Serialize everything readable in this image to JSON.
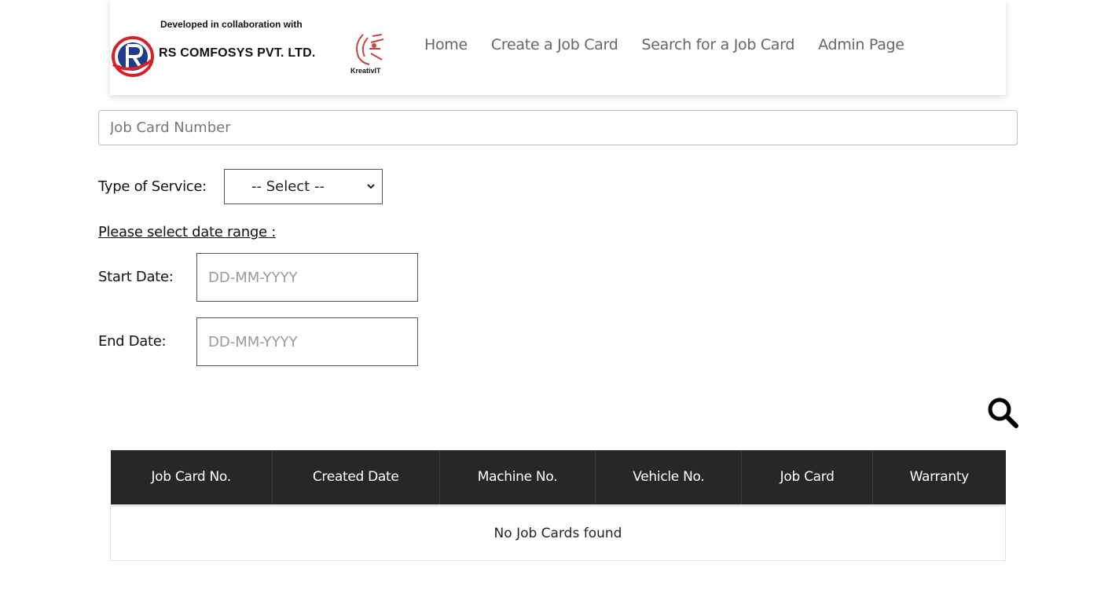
{
  "header": {
    "collab_text": "Developed in collaboration with",
    "company_name": "RS COMFOSYS PVT. LTD.",
    "partner_name": "KreativIT",
    "nav": [
      {
        "label": "Home"
      },
      {
        "label": "Create a Job Card"
      },
      {
        "label": "Search for a Job Card"
      },
      {
        "label": "Admin Page"
      }
    ]
  },
  "form": {
    "job_card_placeholder": "Job Card Number",
    "service_label": "Type of Service:",
    "service_selected": "-- Select --",
    "range_title": "Please select date range :",
    "start_label": "Start Date:",
    "start_placeholder": "DD-MM-YYYY",
    "end_label": "End Date:",
    "end_placeholder": "DD-MM-YYYY"
  },
  "table": {
    "headers": [
      "Job Card No.",
      "Created Date",
      "Machine No.",
      "Vehicle No.",
      "Job Card",
      "Warranty"
    ],
    "empty_message": "No Job Cards found"
  },
  "icons": {
    "search": "search-icon"
  },
  "colors": {
    "nav_text": "#666666",
    "table_header_bg": "#272727",
    "logo_red": "#d2232a",
    "logo_blue": "#1f3c88"
  }
}
